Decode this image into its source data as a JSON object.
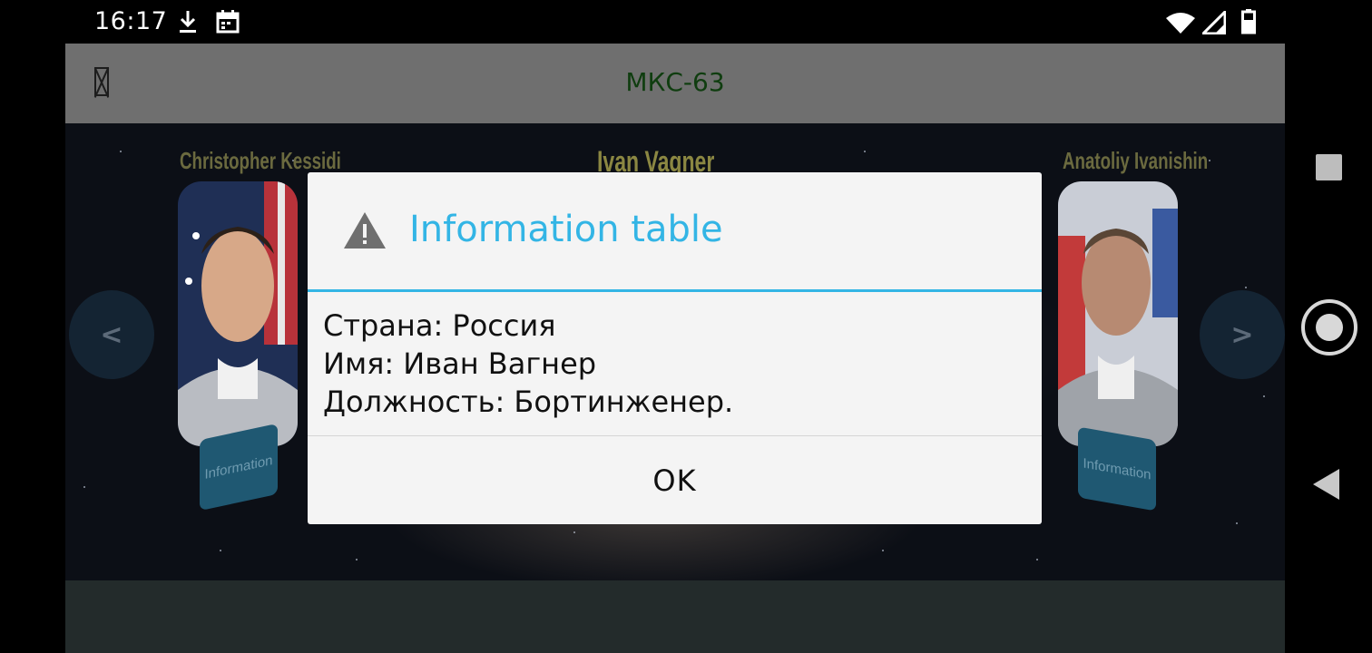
{
  "status_bar": {
    "time": "16:17",
    "left_icons": [
      "download-icon",
      "calendar-icon"
    ],
    "right_icons": [
      "wifi-icon",
      "signal-icon",
      "battery-icon"
    ]
  },
  "toolbar": {
    "title": "МКС-63",
    "menu_icon": "menu-icon"
  },
  "crew": {
    "left": {
      "name": "Christopher Kessidi",
      "button_label": "Information"
    },
    "center": {
      "name": "Ivan Vagner"
    },
    "right": {
      "name": "Anatoliy Ivanishin",
      "button_label": "Information"
    }
  },
  "carousel": {
    "prev_label": "<",
    "next_label": ">"
  },
  "dialog": {
    "icon": "warning-icon",
    "title": "Information table",
    "lines": [
      "Страна: Россия",
      "Имя: Иван Вагнер",
      "Должность: Бортинженер."
    ],
    "ok_label": "OK"
  },
  "colors": {
    "accent": "#33b5e5",
    "toolbar": "#6f6f6f",
    "toolbar_title": "#0f3d0f",
    "dialog_bg": "#f4f4f4",
    "bottom_panel": "#232b2b"
  },
  "nav_bar": {
    "icons": [
      "recents-icon",
      "home-icon",
      "back-icon"
    ]
  }
}
